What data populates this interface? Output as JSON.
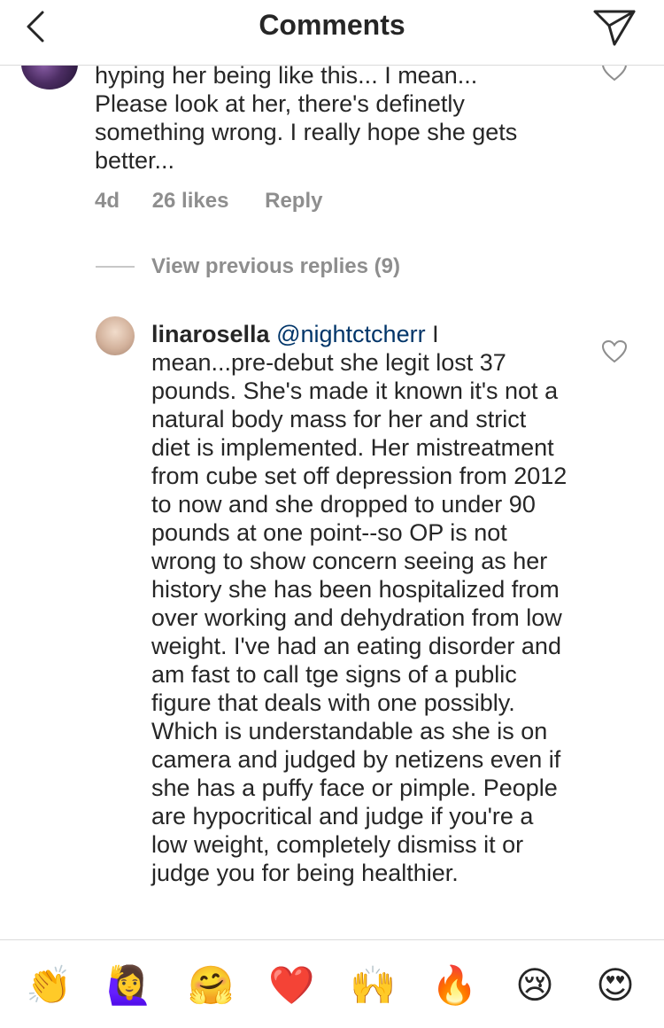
{
  "header": {
    "title": "Comments"
  },
  "first_comment": {
    "text": "hyping her being like this... I mean...\nPlease look at her, there's definetly\nsomething wrong. I really hope she gets\nbetter...",
    "age": "4d",
    "likes": "26 likes",
    "reply_label": "Reply"
  },
  "replies": {
    "label": "View previous replies (9)"
  },
  "reply_comment": {
    "username": "linarosella",
    "mention": "@nightctcherr",
    "text": " I mean...pre-debut she legit lost 37 pounds. She's made it known it's not a natural body mass for her and strict diet is implemented.  Her mistreatment from cube set off depression from 2012 to now and she dropped to under 90 pounds at one point--so OP is not wrong to show concern seeing as her history she has been hospitalized from over working and dehydration from low weight. I've had an eating disorder and am fast to call tge signs of a public figure that deals with one possibly. Which is understandable as she is on camera and judged by netizens even if she has a puffy face or pimple. People are hypocritical and judge if you're a low weight, completely dismiss it or judge you for being healthier."
  },
  "emoji_bar": {
    "emojis": [
      "👏",
      "🙋‍♀️",
      "🤗",
      "❤️",
      "🙌",
      "🔥",
      "😢",
      "😍"
    ]
  },
  "colors": {
    "text": "#262626",
    "muted": "#8e8e8e",
    "mention": "#003569",
    "divider": "#dbdbdb"
  }
}
